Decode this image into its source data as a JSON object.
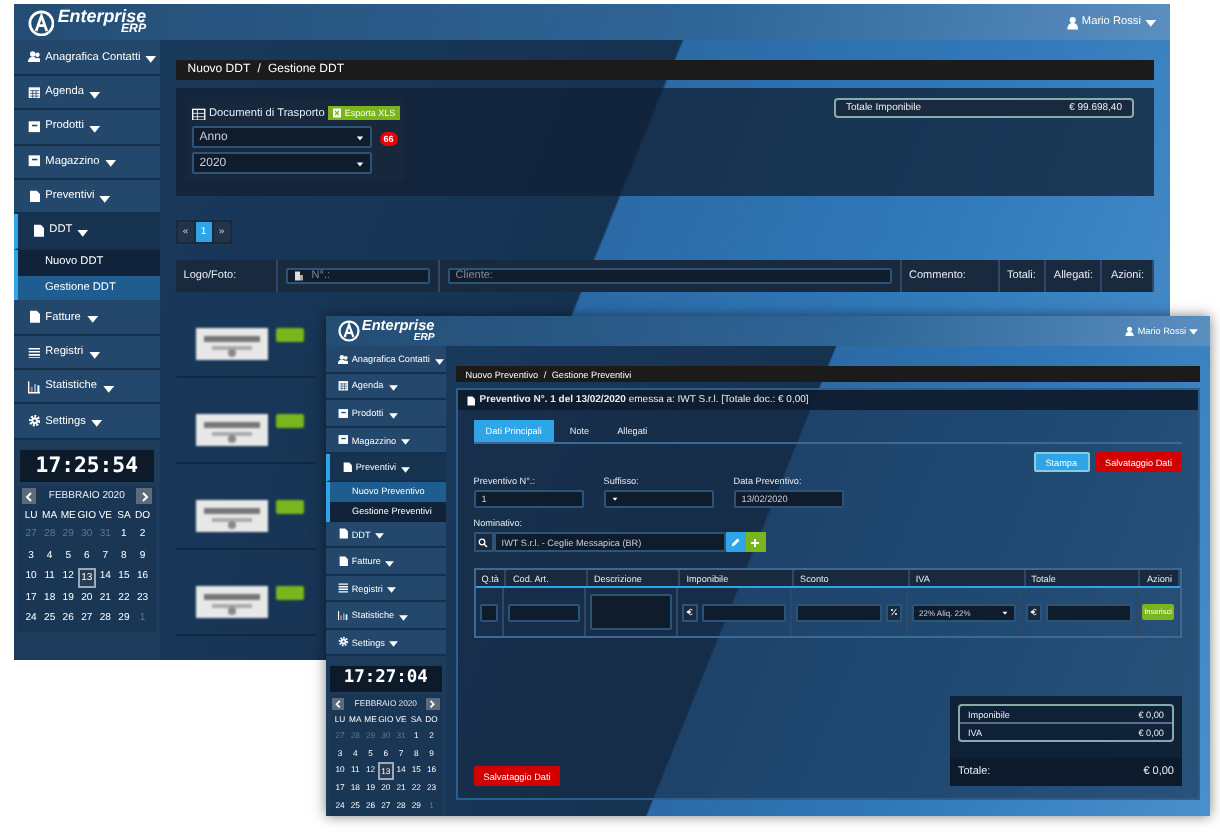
{
  "back_window": {
    "header": {
      "logo": "Enterprise",
      "logo_sub": "ERP",
      "user": "Mario Rossi"
    },
    "sidebar": {
      "items": [
        {
          "label": "Anagrafica Contatti",
          "expanded": false
        },
        {
          "label": "Agenda",
          "expanded": false
        },
        {
          "label": "Prodotti",
          "expanded": false
        },
        {
          "label": "Magazzino",
          "expanded": false
        },
        {
          "label": "Preventivi",
          "expanded": false
        },
        {
          "label": "DDT",
          "expanded": true,
          "children": [
            {
              "label": "Nuovo DDT",
              "selected": false
            },
            {
              "label": "Gestione DDT",
              "selected": true
            }
          ]
        },
        {
          "label": "Fatture",
          "expanded": false
        },
        {
          "label": "Registri",
          "expanded": false
        },
        {
          "label": "Statistiche",
          "expanded": false
        },
        {
          "label": "Settings",
          "expanded": false
        }
      ]
    },
    "clock": "17:25:54",
    "calendar": {
      "title": "FEBBRAIO 2020",
      "weekdays": [
        "LU",
        "MA",
        "ME",
        "GIO",
        "VE",
        "SA",
        "DO"
      ],
      "days": [
        {
          "d": "27",
          "muted": true,
          "selected": false
        },
        {
          "d": "28",
          "muted": true,
          "selected": false
        },
        {
          "d": "29",
          "muted": true,
          "selected": false
        },
        {
          "d": "30",
          "muted": true,
          "selected": false
        },
        {
          "d": "31",
          "muted": true,
          "selected": false
        },
        {
          "d": "1",
          "muted": false,
          "selected": false
        },
        {
          "d": "2",
          "muted": false,
          "selected": false
        },
        {
          "d": "3",
          "muted": false,
          "selected": false
        },
        {
          "d": "4",
          "muted": false,
          "selected": false
        },
        {
          "d": "5",
          "muted": false,
          "selected": false
        },
        {
          "d": "6",
          "muted": false,
          "selected": false
        },
        {
          "d": "7",
          "muted": false,
          "selected": false
        },
        {
          "d": "8",
          "muted": false,
          "selected": false
        },
        {
          "d": "9",
          "muted": false,
          "selected": false
        },
        {
          "d": "10",
          "muted": false,
          "selected": false
        },
        {
          "d": "11",
          "muted": false,
          "selected": false
        },
        {
          "d": "12",
          "muted": false,
          "selected": false
        },
        {
          "d": "13",
          "muted": false,
          "selected": true
        },
        {
          "d": "14",
          "muted": false,
          "selected": false
        },
        {
          "d": "15",
          "muted": false,
          "selected": false
        },
        {
          "d": "16",
          "muted": false,
          "selected": false
        },
        {
          "d": "17",
          "muted": false,
          "selected": false
        },
        {
          "d": "18",
          "muted": false,
          "selected": false
        },
        {
          "d": "19",
          "muted": false,
          "selected": false
        },
        {
          "d": "20",
          "muted": false,
          "selected": false
        },
        {
          "d": "21",
          "muted": false,
          "selected": false
        },
        {
          "d": "22",
          "muted": false,
          "selected": false
        },
        {
          "d": "23",
          "muted": false,
          "selected": false
        },
        {
          "d": "24",
          "muted": false,
          "selected": false
        },
        {
          "d": "25",
          "muted": false,
          "selected": false
        },
        {
          "d": "26",
          "muted": false,
          "selected": false
        },
        {
          "d": "27",
          "muted": false,
          "selected": false
        },
        {
          "d": "28",
          "muted": false,
          "selected": false
        },
        {
          "d": "29",
          "muted": false,
          "selected": false
        },
        {
          "d": "1",
          "muted": true,
          "selected": false
        }
      ]
    },
    "breadcrumb": {
      "items": [
        "Nuovo DDT",
        "Gestione DDT"
      ],
      "separator": "/"
    },
    "ddt_panel": {
      "title": "Documenti di Trasporto",
      "export_button": "Esporta XLS",
      "selects": [
        "Anno",
        "2020"
      ],
      "badge": "66"
    },
    "total_box": {
      "label": "Totale Imponibile",
      "value": "€ 99.698,40"
    },
    "pagination": [
      {
        "label": "«",
        "selected": false
      },
      {
        "label": "1",
        "selected": true
      },
      {
        "label": "»",
        "selected": false
      }
    ],
    "table": {
      "columns": [
        {
          "kind": "label",
          "text": "Logo/Foto:"
        },
        {
          "kind": "filter",
          "placeholder": "N°.:"
        },
        {
          "kind": "filter",
          "placeholder": "Cliente:"
        },
        {
          "kind": "label",
          "text": "Commento:"
        },
        {
          "kind": "label",
          "text": "Totali:"
        },
        {
          "kind": "label",
          "text": "Allegati:"
        },
        {
          "kind": "label",
          "text": "Azioni:"
        }
      ]
    }
  },
  "front_window": {
    "header": {
      "logo": "Enterprise",
      "logo_sub": "ERP",
      "user": "Mario Rossi"
    },
    "sidebar": {
      "items": [
        {
          "label": "Anagrafica Contatti",
          "expanded": false
        },
        {
          "label": "Agenda",
          "expanded": false
        },
        {
          "label": "Prodotti",
          "expanded": false
        },
        {
          "label": "Magazzino",
          "expanded": false
        },
        {
          "label": "Preventivi",
          "expanded": true,
          "children": [
            {
              "label": "Nuovo Preventivo",
              "selected": true
            },
            {
              "label": "Gestione Preventivi",
              "selected": false
            }
          ]
        },
        {
          "label": "DDT",
          "expanded": false
        },
        {
          "label": "Fatture",
          "expanded": false
        },
        {
          "label": "Registri",
          "expanded": false
        },
        {
          "label": "Statistiche",
          "expanded": false
        },
        {
          "label": "Settings",
          "expanded": false
        }
      ]
    },
    "clock": "17:27:04",
    "calendar": {
      "title": "FEBBRAIO 2020",
      "weekdays": [
        "LU",
        "MA",
        "ME",
        "GIO",
        "VE",
        "SA",
        "DO"
      ],
      "days": [
        {
          "d": "27",
          "muted": true,
          "selected": false
        },
        {
          "d": "28",
          "muted": true,
          "selected": false
        },
        {
          "d": "29",
          "muted": true,
          "selected": false
        },
        {
          "d": "30",
          "muted": true,
          "selected": false
        },
        {
          "d": "31",
          "muted": true,
          "selected": false
        },
        {
          "d": "1",
          "muted": false,
          "selected": false
        },
        {
          "d": "2",
          "muted": false,
          "selected": false
        },
        {
          "d": "3",
          "muted": false,
          "selected": false
        },
        {
          "d": "4",
          "muted": false,
          "selected": false
        },
        {
          "d": "5",
          "muted": false,
          "selected": false
        },
        {
          "d": "6",
          "muted": false,
          "selected": false
        },
        {
          "d": "7",
          "muted": false,
          "selected": false
        },
        {
          "d": "8",
          "muted": false,
          "selected": false
        },
        {
          "d": "9",
          "muted": false,
          "selected": false
        },
        {
          "d": "10",
          "muted": false,
          "selected": false
        },
        {
          "d": "11",
          "muted": false,
          "selected": false
        },
        {
          "d": "12",
          "muted": false,
          "selected": false
        },
        {
          "d": "13",
          "muted": false,
          "selected": true
        },
        {
          "d": "14",
          "muted": false,
          "selected": false
        },
        {
          "d": "15",
          "muted": false,
          "selected": false
        },
        {
          "d": "16",
          "muted": false,
          "selected": false
        },
        {
          "d": "17",
          "muted": false,
          "selected": false
        },
        {
          "d": "18",
          "muted": false,
          "selected": false
        },
        {
          "d": "19",
          "muted": false,
          "selected": false
        },
        {
          "d": "20",
          "muted": false,
          "selected": false
        },
        {
          "d": "21",
          "muted": false,
          "selected": false
        },
        {
          "d": "22",
          "muted": false,
          "selected": false
        },
        {
          "d": "23",
          "muted": false,
          "selected": false
        },
        {
          "d": "24",
          "muted": false,
          "selected": false
        },
        {
          "d": "25",
          "muted": false,
          "selected": false
        },
        {
          "d": "26",
          "muted": false,
          "selected": false
        },
        {
          "d": "27",
          "muted": false,
          "selected": false
        },
        {
          "d": "28",
          "muted": false,
          "selected": false
        },
        {
          "d": "29",
          "muted": false,
          "selected": false
        },
        {
          "d": "1",
          "muted": true,
          "selected": false
        }
      ]
    },
    "breadcrumb": {
      "items": [
        "Nuovo Preventivo",
        "Gestione Preventivi"
      ],
      "separator": "/"
    },
    "title": "**Preventivo N°. 1 del 13/02/2020** emessa a: IWT S.r.l. [Totale doc.: € 0,00]",
    "tabs": [
      {
        "label": "Dati Principali",
        "selected": true
      },
      {
        "label": "Note",
        "selected": false
      },
      {
        "label": "Allegati",
        "selected": false
      }
    ],
    "actions": [
      {
        "label": "Stampa",
        "kind": "primary"
      },
      {
        "label": "Salvataggio Dati",
        "kind": "danger"
      }
    ],
    "fields": [
      {
        "label": "Preventivo N°.:",
        "kind": "text",
        "value": "1"
      },
      {
        "label": "Suffisso:",
        "kind": "select"
      },
      {
        "label": "Data Preventivo:",
        "kind": "text",
        "value": "13/02/2020"
      }
    ],
    "nominativo": {
      "label": "Nominativo:",
      "value": "IWT S.r.l. - Ceglie Messapica (BR)"
    },
    "lines": {
      "columns": [
        "Q.tà",
        "Cod. Art.",
        "Descrizione",
        "Imponibile",
        "Sconto",
        "IVA",
        "Totale",
        "Azioni"
      ],
      "vat": "22% Aliq. 22%",
      "insert_button": "Inserisci"
    },
    "summary": [
      {
        "label": "Imponibile",
        "value": "€ 0,00"
      },
      {
        "label": "IVA",
        "value": "€ 0,00"
      }
    ],
    "total": {
      "label": "Totale:",
      "value": "€ 0,00"
    },
    "save_button": "Salvataggio Dati"
  }
}
